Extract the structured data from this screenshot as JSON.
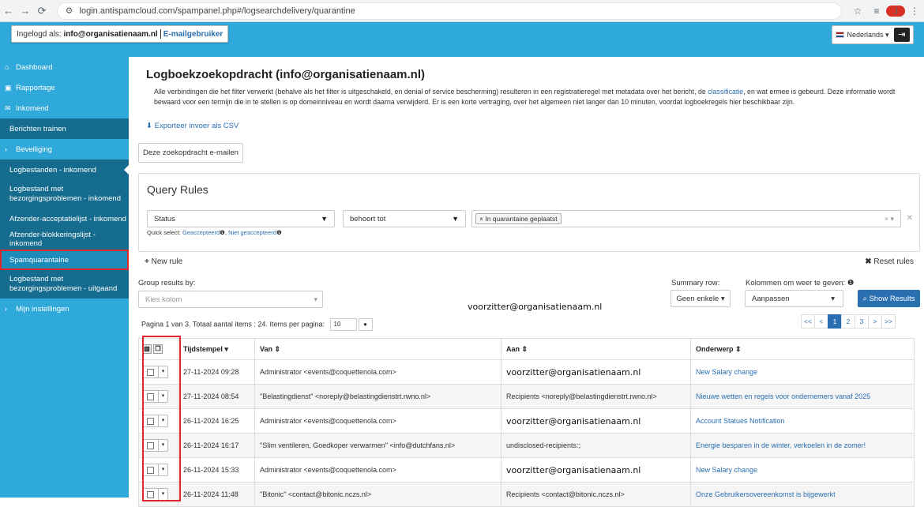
{
  "browser": {
    "url": "login.antispamcloud.com/spampanel.php#/logsearchdelivery/quarantine",
    "profile_initial": "J"
  },
  "header": {
    "login_label": "Ingelogd als:",
    "login_email": "info@organisatienaam.nl",
    "role": "E-mailgebruiker",
    "language": "Nederlands"
  },
  "sidebar": {
    "items": [
      {
        "label": "Dashboard"
      },
      {
        "label": "Rapportage"
      },
      {
        "label": "Inkomend"
      },
      {
        "label": "Berichten trainen"
      },
      {
        "label": "Beveiliging"
      },
      {
        "label": "Logbestanden - inkomend"
      },
      {
        "label": "Logbestand met bezorgingsproblemen - inkomend"
      },
      {
        "label": "Afzender-acceptatielijst - inkomend"
      },
      {
        "label": "Afzender-blokkeringslijst - inkomend"
      },
      {
        "label": "Spamquarantaine"
      },
      {
        "label": "Logbestand met bezorgingsproblemen - uitgaand"
      },
      {
        "label": "Mijn instellingen"
      }
    ]
  },
  "main": {
    "title": "Logboekzoekopdracht (info@organisatienaam.nl)",
    "description_part1": "Alle verbindingen die het filter verwerkt (behalve als het filter is uitgeschakeld, en denial of service bescherming) resulteren in een registratieregel met metadata over het bericht, de ",
    "description_link": "classificatie",
    "description_part2": ", en wat ermee is gebeurd. Deze informatie wordt bewaard voor een termijn die in te stellen is op domeinniveau en wordt daarna verwijderd. Er is een korte vertraging, over het algemeen niet langer dan 10 minuten, voordat logboekregels hier beschikbaar zijn.",
    "export_label": "Exporteer invoer als CSV",
    "email_button": "Deze zoekopdracht e-mailen",
    "query_rules": {
      "title": "Query Rules",
      "field": "Status",
      "operator": "behoort tot",
      "value_tag": "In quarantaine geplaatst",
      "quick_select_label": "Quick select:",
      "quick_accepted": "Geaccepteerd",
      "quick_not_accepted": "Niet geaccepteerd"
    },
    "new_rule": "New rule",
    "reset_rules": "Reset rules",
    "group_by_label": "Group results by:",
    "group_by_placeholder": "Kies kolom",
    "summary_row_label": "Summary row:",
    "summary_row_value": "Geen enkele",
    "columns_label": "Kolommen om weer te geven:",
    "columns_value": "Aanpassen",
    "show_results": "Show Results",
    "overlay_email": "voorzitter@organisatienaam.nl",
    "pagination_text": "Pagina 1 van 3. Totaal aantal items : 24. Items per pagina:",
    "items_per_page": "10",
    "pager": [
      "<<",
      "<",
      "1",
      "2",
      "3",
      ">",
      ">>"
    ],
    "pager_active": "1"
  },
  "table": {
    "headers": [
      "Tijdstempel",
      "Van",
      "Aan",
      "Onderwerp"
    ],
    "rows": [
      {
        "time": "27-11-2024 09:28",
        "from": "Administrator <events@coquettenola.com>",
        "to": "voorzitter@organisatienaam.nl",
        "subject": "New Salary change"
      },
      {
        "time": "27-11-2024 08:54",
        "from": "\"Belastingdienst\" <noreply@belastingdienstrt.rwno.nl>",
        "to": "Recipients <noreply@belastingdienstrt.rwno.nl>",
        "subject": "Nieuwe wetten en regels voor ondernemers vanaf 2025"
      },
      {
        "time": "26-11-2024 16:25",
        "from": "Administrator <events@coquettenola.com>",
        "to": "voorzitter@organisatienaam.nl",
        "subject": "Account Statues Notification"
      },
      {
        "time": "26-11-2024 16:17",
        "from": "\"Slim ventileren, Goedkoper verwarmen\" <info@dutchfans.nl>",
        "to": "undisclosed-recipients:;",
        "subject": "Energie besparen in de winter, verkoelen in de zomer!"
      },
      {
        "time": "26-11-2024 15:33",
        "from": "Administrator <events@coquettenola.com>",
        "to": "voorzitter@organisatienaam.nl",
        "subject": "New Salary change"
      },
      {
        "time": "26-11-2024 11:48",
        "from": "\"Bitonic\" <contact@bitonic.nczs.nl>",
        "to": "Recipients <contact@bitonic.nczs.nl>",
        "subject": "Onze Gebruikersovereenkomst is bijgewerkt"
      }
    ]
  },
  "colors": {
    "brand": "#2fa8da",
    "sidebar_dark": "#156c8e",
    "link": "#2a6fb0",
    "highlight": "#e0262b"
  }
}
